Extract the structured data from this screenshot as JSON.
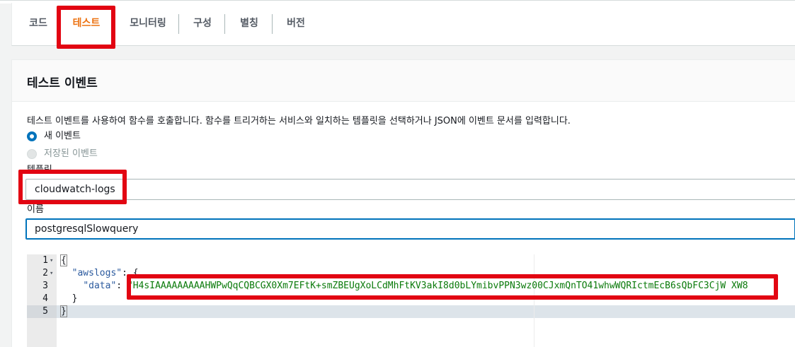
{
  "tabs": [
    {
      "label": "코드",
      "active": false
    },
    {
      "label": "테스트",
      "active": true
    },
    {
      "label": "모니터링",
      "active": false
    },
    {
      "label": "구성",
      "active": false
    },
    {
      "label": "별칭",
      "active": false
    },
    {
      "label": "버전",
      "active": false
    }
  ],
  "panel": {
    "title": "테스트 이벤트",
    "description": "테스트 이벤트를 사용하여 함수를 호출합니다. 함수를 트리거하는 서비스와 일치하는 템플릿을 선택하거나 JSON에 이벤트 문서를 입력합니다.",
    "radio_new": "새 이벤트",
    "radio_saved": "저장된 이벤트",
    "template_label": "템플릿",
    "template_value": "cloudwatch-logs",
    "name_label": "이름",
    "name_value": "postgresqlSlowquery"
  },
  "editor": {
    "line_numbers": [
      "1",
      "2",
      "3",
      "4",
      "5"
    ],
    "line1": "{",
    "line2_key": "\"awslogs\"",
    "line2_rest": ": {",
    "line3_key": "\"data\"",
    "line3_colon": ": ",
    "line3_value": "\"H4sIAAAAAAAAAHWPwQqCQBCGX0Xm7EFtK+smZBEUgXoLCdMhFtKV3akI8d0bLYmibvPPN3wz00CJxmQnTO41whwWQRIctmEcB6sQbFC3CjW XW8",
    "line4": "}",
    "line5": "}"
  },
  "colors": {
    "active_tab": "#ec7211",
    "focus_border": "#0073bb",
    "annotation_red": "#e20512"
  }
}
